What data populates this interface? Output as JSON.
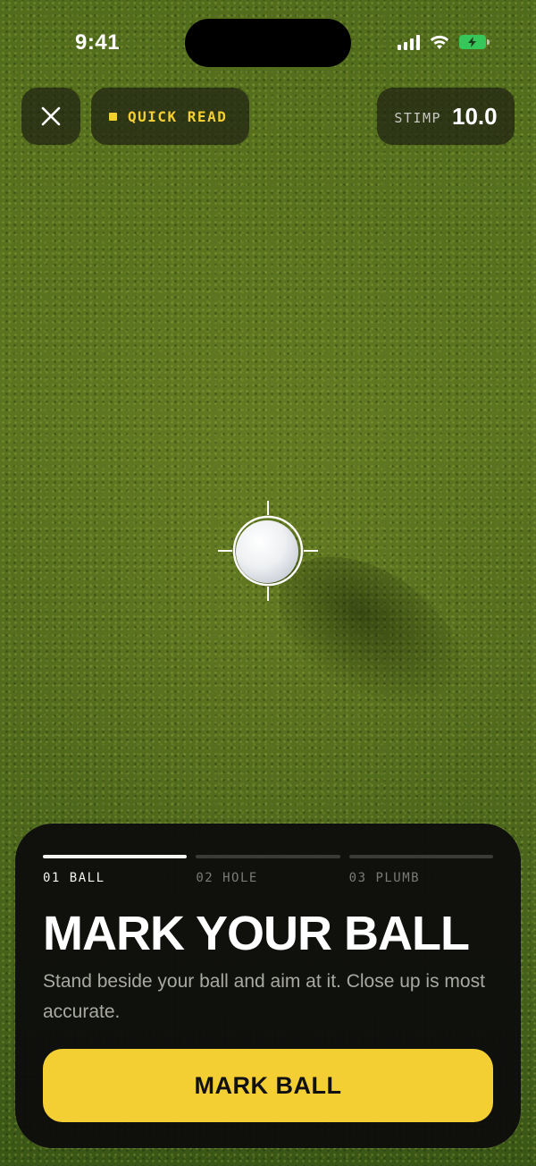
{
  "status_bar": {
    "time": "9:41"
  },
  "top_bar": {
    "close_icon": "close-icon",
    "mode_label": "QUICK READ",
    "stimp_label": "STIMP",
    "stimp_value": "10.0"
  },
  "sheet": {
    "steps": [
      {
        "label": "01 BALL",
        "active": true
      },
      {
        "label": "02 HOLE",
        "active": false
      },
      {
        "label": "03 PLUMB",
        "active": false
      }
    ],
    "title": "MARK YOUR BALL",
    "description": "Stand beside your ball and aim at it. Close up is most accurate.",
    "button_label": "MARK BALL"
  },
  "colors": {
    "accent": "#f4cf34",
    "sheet_bg": "#0e0e0c",
    "battery": "#35c759"
  }
}
